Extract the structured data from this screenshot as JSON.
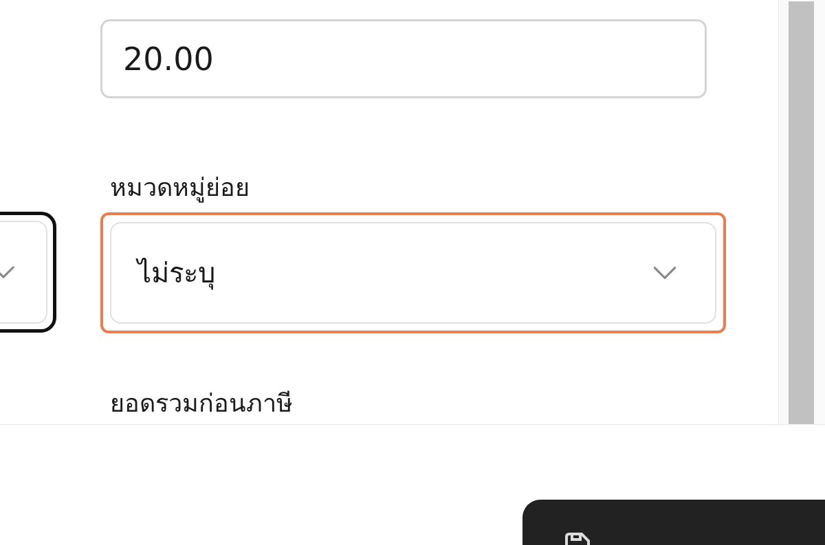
{
  "form": {
    "fields": [
      {
        "kind": "input",
        "value": "20.00"
      },
      {
        "kind": "select",
        "label": "หมวดหมู่ย่อย",
        "value": "ไม่ระบุ",
        "highlighted": true
      },
      {
        "kind": "heading",
        "label": "ยอดรวมก่อนภาษี"
      }
    ]
  }
}
